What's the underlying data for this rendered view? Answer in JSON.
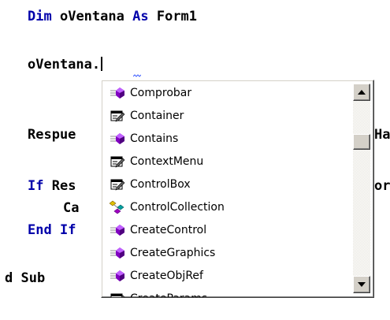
{
  "editor": {
    "line1": {
      "kw1": "Dim",
      "ident": "oVentana",
      "kw2": "As",
      "type": "Form1"
    },
    "line2": {
      "text": "oVentana."
    },
    "line3": {
      "text": "Respue",
      "tail": "Ha"
    },
    "line4": {
      "kw": "If",
      "text": " Res",
      "tail": "or"
    },
    "line5": {
      "text": "Ca"
    },
    "line6": {
      "kw1": "End",
      "kw2": "If"
    },
    "line7": {
      "text": "d Sub"
    }
  },
  "completion": {
    "items": [
      {
        "label": "Comprobar",
        "icon": "method-icon"
      },
      {
        "label": "Container",
        "icon": "property-icon"
      },
      {
        "label": "Contains",
        "icon": "method-icon"
      },
      {
        "label": "ContextMenu",
        "icon": "property-icon"
      },
      {
        "label": "ControlBox",
        "icon": "property-icon"
      },
      {
        "label": "ControlCollection",
        "icon": "class-icon"
      },
      {
        "label": "CreateControl",
        "icon": "method-icon"
      },
      {
        "label": "CreateGraphics",
        "icon": "method-icon"
      },
      {
        "label": "CreateObjRef",
        "icon": "method-icon"
      },
      {
        "label": "CreateParams",
        "icon": "property-icon"
      }
    ],
    "scroll_position_fraction": 0.24
  },
  "colors": {
    "keyword": "#0000aa",
    "method_purple": "#8000c0",
    "ui_face": "#d4d0c8"
  }
}
